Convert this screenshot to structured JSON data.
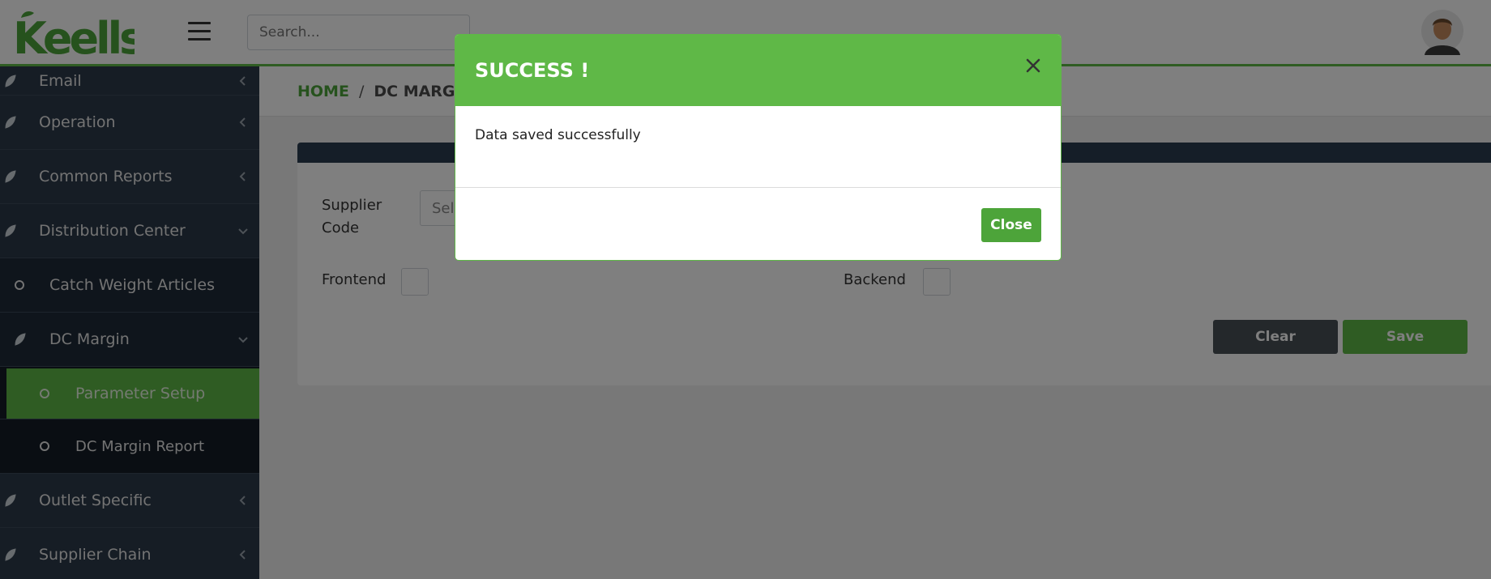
{
  "header": {
    "logo_text": "Keells",
    "search_placeholder": "Search..."
  },
  "sidebar": {
    "items": [
      {
        "label": "Email"
      },
      {
        "label": "Operation"
      },
      {
        "label": "Common Reports"
      },
      {
        "label": "Distribution Center"
      },
      {
        "label": "Catch Weight Articles"
      },
      {
        "label": "DC Margin"
      },
      {
        "label": "Parameter Setup"
      },
      {
        "label": "DC Margin Report"
      },
      {
        "label": "Outlet Specific"
      },
      {
        "label": "Supplier Chain"
      }
    ]
  },
  "breadcrumb": {
    "home": "HOME",
    "separator": "/",
    "current": "DC MARGIN"
  },
  "form": {
    "supplier_code_label_line1": "Supplier",
    "supplier_code_label_line2": "Code",
    "supplier_select_placeholder": "Sele",
    "frontend_label": "Frontend",
    "backend_label": "Backend",
    "clear_label": "Clear",
    "save_label": "Save"
  },
  "modal": {
    "title": "SUCCESS !",
    "message": "Data saved successfully",
    "close_label": "Close"
  },
  "colors": {
    "brand_green": "#5fb847",
    "sidebar_bg": "#2d3a4a",
    "card_header": "#2b3d50"
  }
}
